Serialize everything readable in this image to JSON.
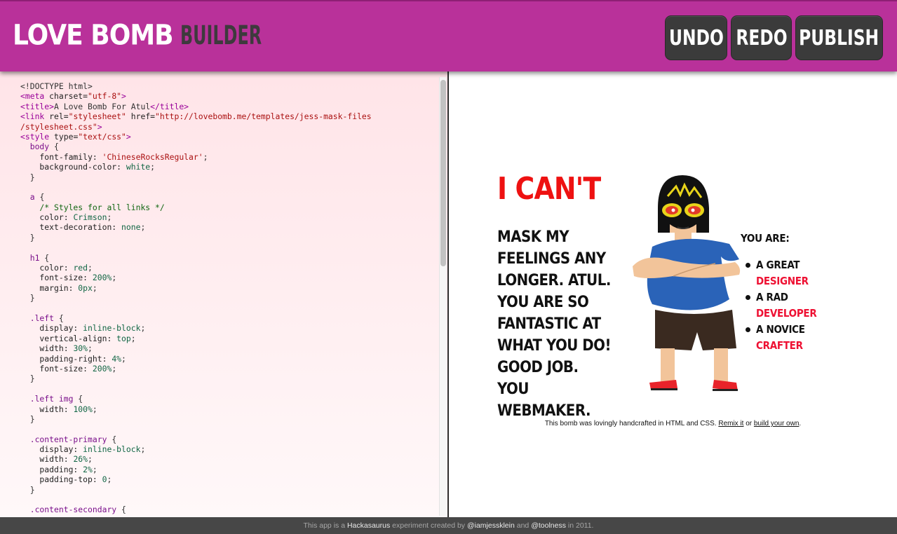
{
  "header": {
    "logo_love": "LOVE BOMB",
    "logo_builder": "BUILDER",
    "undo_label": "UNDO",
    "redo_label": "REDO",
    "publish_label": "PUBLISH",
    "bg_color": "#b9319a"
  },
  "editor": {
    "lines": [
      [
        [
          "t-plain",
          "<!DOCTYPE html>"
        ]
      ],
      [
        [
          "t-tag",
          "<meta "
        ],
        [
          "t-attr",
          "charset="
        ],
        [
          "t-str",
          "\"utf-8\""
        ],
        [
          "t-tag",
          ">"
        ]
      ],
      [
        [
          "t-tag",
          "<title>"
        ],
        [
          "t-plain",
          "A Love Bomb For Atul"
        ],
        [
          "t-tag",
          "</title>"
        ]
      ],
      [
        [
          "t-tag",
          "<link "
        ],
        [
          "t-attr",
          "rel="
        ],
        [
          "t-str",
          "\"stylesheet\" "
        ],
        [
          "t-attr",
          "href="
        ],
        [
          "t-str",
          "\"http://lovebomb.me/templates/jess-mask-files"
        ]
      ],
      [
        [
          "t-str",
          "/stylesheet.css\""
        ],
        [
          "t-tag",
          ">"
        ]
      ],
      [
        [
          "t-tag",
          "<style "
        ],
        [
          "t-attr",
          "type="
        ],
        [
          "t-str",
          "\"text/css\""
        ],
        [
          "t-tag",
          ">"
        ]
      ],
      [
        [
          "t-sel",
          "  body "
        ],
        [
          "t-plain",
          "{"
        ]
      ],
      [
        [
          "t-prop",
          "    font-family: "
        ],
        [
          "t-strv",
          "'ChineseRocksRegular'"
        ],
        [
          "t-plain",
          ";"
        ]
      ],
      [
        [
          "t-prop",
          "    background-color: "
        ],
        [
          "t-val",
          "white"
        ],
        [
          "t-plain",
          ";"
        ]
      ],
      [
        [
          "t-plain",
          "  }"
        ]
      ],
      [
        [
          "t-plain",
          ""
        ]
      ],
      [
        [
          "t-sel",
          "  a "
        ],
        [
          "t-plain",
          "{"
        ]
      ],
      [
        [
          "t-cmt",
          "    /* Styles for all links */"
        ]
      ],
      [
        [
          "t-prop",
          "    color: "
        ],
        [
          "t-val",
          "Crimson"
        ],
        [
          "t-plain",
          ";"
        ]
      ],
      [
        [
          "t-prop",
          "    text-decoration: "
        ],
        [
          "t-val",
          "none"
        ],
        [
          "t-plain",
          ";"
        ]
      ],
      [
        [
          "t-plain",
          "  }"
        ]
      ],
      [
        [
          "t-plain",
          ""
        ]
      ],
      [
        [
          "t-sel",
          "  h1 "
        ],
        [
          "t-plain",
          "{"
        ]
      ],
      [
        [
          "t-prop",
          "    color: "
        ],
        [
          "t-val",
          "red"
        ],
        [
          "t-plain",
          ";"
        ]
      ],
      [
        [
          "t-prop",
          "    font-size: "
        ],
        [
          "t-val",
          "200%"
        ],
        [
          "t-plain",
          ";"
        ]
      ],
      [
        [
          "t-prop",
          "    margin: "
        ],
        [
          "t-val",
          "0px"
        ],
        [
          "t-plain",
          ";"
        ]
      ],
      [
        [
          "t-plain",
          "  }"
        ]
      ],
      [
        [
          "t-plain",
          ""
        ]
      ],
      [
        [
          "t-sel",
          "  .left "
        ],
        [
          "t-plain",
          "{"
        ]
      ],
      [
        [
          "t-prop",
          "    display: "
        ],
        [
          "t-val",
          "inline-block"
        ],
        [
          "t-plain",
          ";"
        ]
      ],
      [
        [
          "t-prop",
          "    vertical-align: "
        ],
        [
          "t-val",
          "top"
        ],
        [
          "t-plain",
          ";"
        ]
      ],
      [
        [
          "t-prop",
          "    width: "
        ],
        [
          "t-val",
          "30%"
        ],
        [
          "t-plain",
          ";"
        ]
      ],
      [
        [
          "t-prop",
          "    padding-right: "
        ],
        [
          "t-val",
          "4%"
        ],
        [
          "t-plain",
          ";"
        ]
      ],
      [
        [
          "t-prop",
          "    font-size: "
        ],
        [
          "t-val",
          "200%"
        ],
        [
          "t-plain",
          ";"
        ]
      ],
      [
        [
          "t-plain",
          "  }"
        ]
      ],
      [
        [
          "t-plain",
          ""
        ]
      ],
      [
        [
          "t-sel",
          "  .left img "
        ],
        [
          "t-plain",
          "{"
        ]
      ],
      [
        [
          "t-prop",
          "    width: "
        ],
        [
          "t-val",
          "100%"
        ],
        [
          "t-plain",
          ";"
        ]
      ],
      [
        [
          "t-plain",
          "  }"
        ]
      ],
      [
        [
          "t-plain",
          ""
        ]
      ],
      [
        [
          "t-sel",
          "  .content-primary "
        ],
        [
          "t-plain",
          "{"
        ]
      ],
      [
        [
          "t-prop",
          "    display: "
        ],
        [
          "t-val",
          "inline-block"
        ],
        [
          "t-plain",
          ";"
        ]
      ],
      [
        [
          "t-prop",
          "    width: "
        ],
        [
          "t-val",
          "26%"
        ],
        [
          "t-plain",
          ";"
        ]
      ],
      [
        [
          "t-prop",
          "    padding: "
        ],
        [
          "t-val",
          "2%"
        ],
        [
          "t-plain",
          ";"
        ]
      ],
      [
        [
          "t-prop",
          "    padding-top: "
        ],
        [
          "t-val",
          "0"
        ],
        [
          "t-plain",
          ";"
        ]
      ],
      [
        [
          "t-plain",
          "  }"
        ]
      ],
      [
        [
          "t-plain",
          ""
        ]
      ],
      [
        [
          "t-sel",
          "  .content-secondary "
        ],
        [
          "t-plain",
          "{"
        ]
      ]
    ]
  },
  "preview": {
    "heading": "I CAN'T",
    "body": "MASK MY FEELINGS ANY LONGER. ATUL. YOU ARE SO FANTASTIC AT WHAT YOU DO! GOOD JOB. YOU WEBMAKER.",
    "side_title": "YOU ARE:",
    "items": [
      {
        "prefix": "A GREAT",
        "role": "DESIGNER"
      },
      {
        "prefix": "A RAD",
        "role": "DEVELOPER"
      },
      {
        "prefix": "A NOVICE",
        "role": "CRAFTER"
      }
    ],
    "credit_prefix": "This bomb was lovingly handcrafted in HTML and CSS. ",
    "credit_link1": "Remix it",
    "credit_mid": " or ",
    "credit_link2": "build your own",
    "credit_suffix": ".",
    "character_icon": "luchador-mask-character"
  },
  "footer": {
    "t1": "This app is a ",
    "hackasaurus": "Hackasaurus",
    "t2": " experiment created by ",
    "author1": "@iamjessklein",
    "t3": " and ",
    "author2": "@toolness",
    "t4": " in 2011."
  }
}
